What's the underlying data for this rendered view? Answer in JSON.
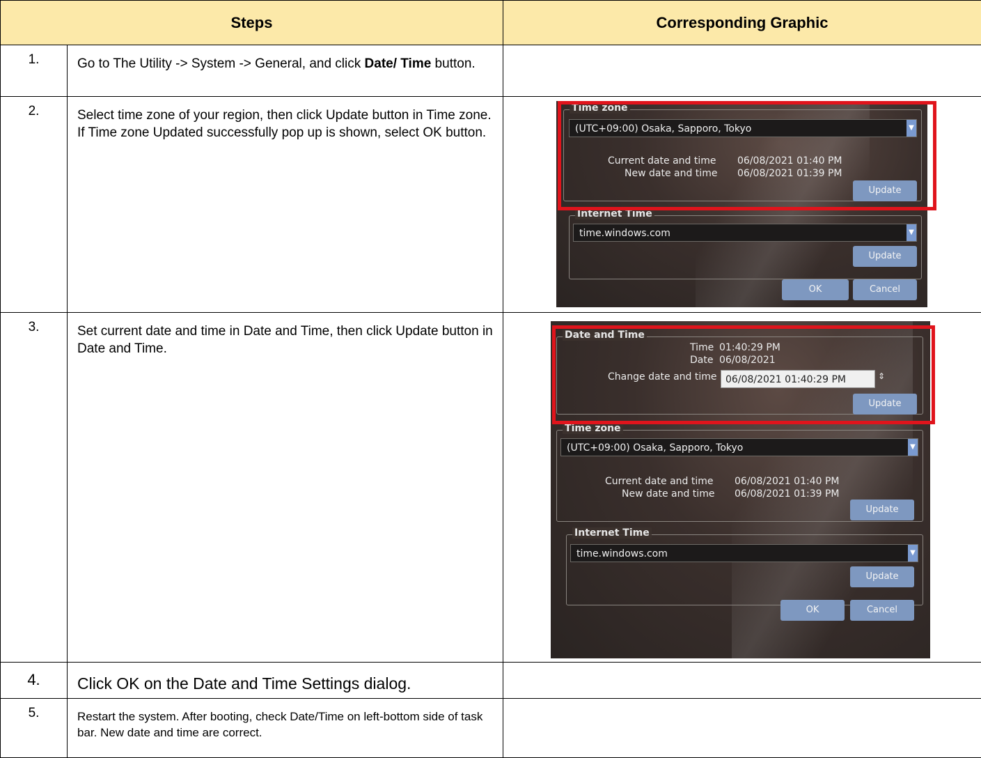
{
  "table": {
    "headers": [
      "Steps",
      "Corresponding Graphic"
    ],
    "rows": [
      {
        "num": "1.",
        "text_pre": "Go to The Utility -> System -> General, and click ",
        "text_bold": "Date/ Time",
        "text_post": " button."
      },
      {
        "num": "2.",
        "text": "Select time zone of your region, then click Update button in Time zone. If Time zone Updated successfully pop up is shown, select OK button."
      },
      {
        "num": "3.",
        "text": "Set current date and time in Date and Time, then click Update button in Date and Time."
      },
      {
        "num": "4.",
        "text": "Click OK on the Date and Time Settings dialog."
      },
      {
        "num": "5.",
        "text": "Restart the system. After booting, check Date/Time on left-bottom side of task bar. New date and time are correct."
      }
    ]
  },
  "dialog": {
    "time_zone_title": "Time zone",
    "time_zone_value": "(UTC+09:00) Osaka, Sapporo, Tokyo",
    "current_dt_label": "Current date and time",
    "current_dt_value": "06/08/2021 01:40 PM",
    "new_dt_label": "New date and time",
    "new_dt_value": "06/08/2021 01:39 PM",
    "update_label": "Update",
    "internet_time_title": "Internet Time",
    "internet_time_value": "time.windows.com",
    "ok_label": "OK",
    "cancel_label": "Cancel",
    "date_time_title": "Date and Time",
    "time_label": "Time",
    "time_value": "01:40:29 PM",
    "date_label": "Date",
    "date_value": "06/08/2021",
    "change_dt_label": "Change date and time",
    "change_dt_value": "06/08/2021 01:40:29 PM"
  },
  "colors": {
    "header_bg": "#fce9a9",
    "highlight": "#e0141c",
    "button": "#7e98c0"
  }
}
